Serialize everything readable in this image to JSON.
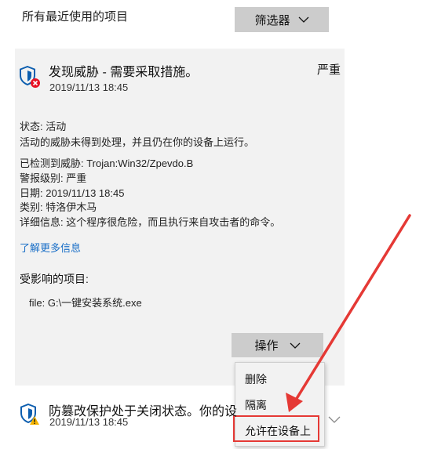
{
  "header": {
    "title": "所有最近使用的项目",
    "filter_label": "筛选器"
  },
  "threat": {
    "title": "发现威胁 - 需要采取措施。",
    "severity": "严重",
    "date": "2019/11/13 18:45",
    "status_line": "状态: 活动",
    "status_desc": "活动的威胁未得到处理，并且仍在你的设备上运行。",
    "detected": "已检测到威胁: Trojan:Win32/Zpevdo.B",
    "alert_level": "警报级别: 严重",
    "date_line": "日期: 2019/11/13 18:45",
    "category": "类别: 特洛伊木马",
    "details": "详细信息: 这个程序很危险，而且执行来自攻击者的命令。",
    "learn_more": "了解更多信息",
    "affected_title": "受影响的项目:",
    "file_path": "file: G:\\一键安装系统.exe",
    "action_label": "操作"
  },
  "menu": {
    "items": [
      "删除",
      "隔离",
      "允许在设备上"
    ]
  },
  "second": {
    "title": "防篡改保护处于关闭状态。你的设备",
    "date": "2019/11/13 18:45"
  },
  "colors": {
    "card_bg": "#f2f2f2",
    "button_bg": "#cccccc",
    "link": "#1a6fc7",
    "shield": "#0c5eaf",
    "error_badge": "#e81123",
    "warning_badge": "#f5b400",
    "annotation_red": "#e53935"
  },
  "icons": {
    "main_threat": "shield-error-icon",
    "second_threat": "shield-warning-icon",
    "dropdown": "chevron-down-icon"
  }
}
